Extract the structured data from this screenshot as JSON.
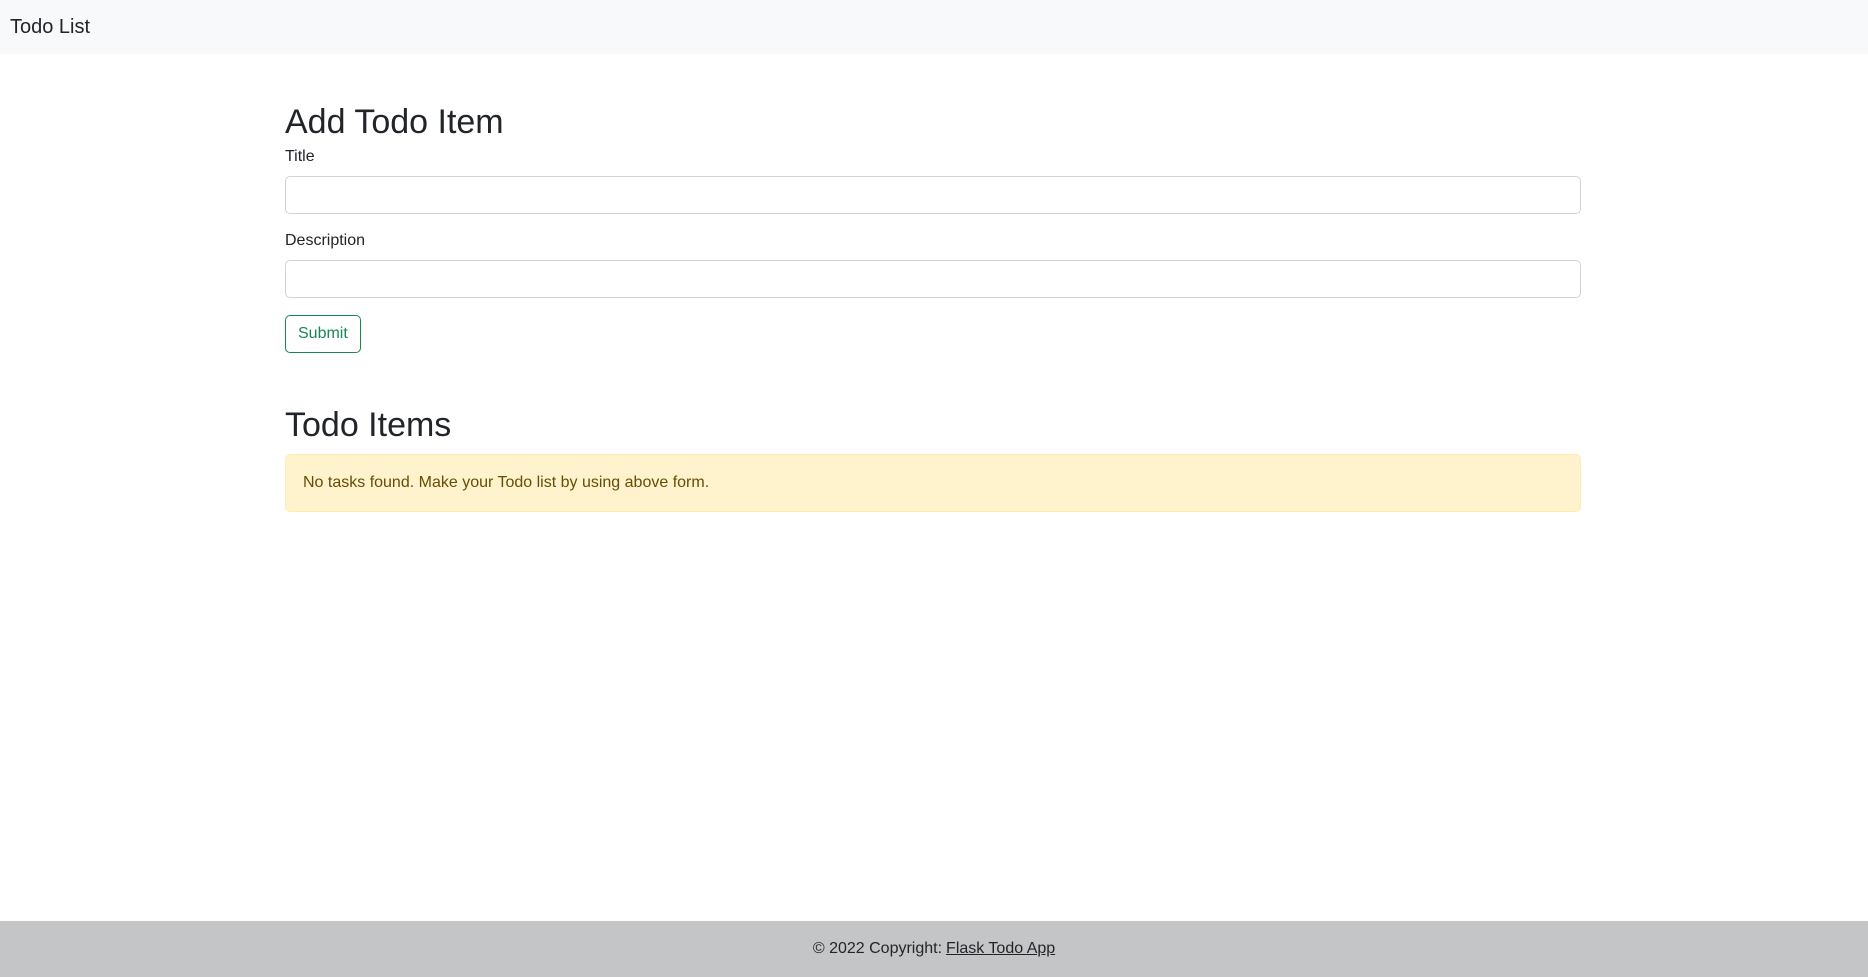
{
  "navbar": {
    "brand": "Todo List"
  },
  "form": {
    "heading": "Add Todo Item",
    "title_label": "Title",
    "title_value": "",
    "description_label": "Description",
    "description_value": "",
    "submit_label": "Submit"
  },
  "items": {
    "heading": "Todo Items",
    "empty_message": "No tasks found. Make your Todo list by using above form."
  },
  "footer": {
    "copyright": "© 2022 Copyright:",
    "link_text": "Flask Todo App"
  },
  "colors": {
    "navbar_bg": "#f8f9fa",
    "submit_accent": "#198754",
    "alert_bg": "#fff3cd",
    "alert_text": "#664d03",
    "footer_bg": "#c4c5c7"
  }
}
